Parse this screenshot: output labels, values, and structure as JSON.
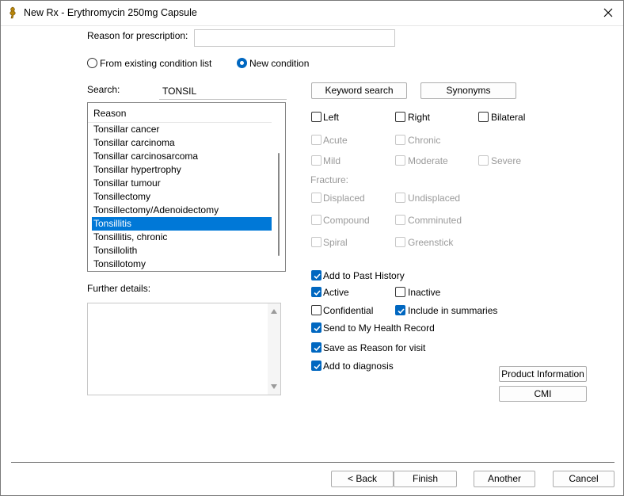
{
  "window": {
    "title": "New Rx - Erythromycin  250mg Capsule",
    "close_label": "×"
  },
  "reason": {
    "label": "Reason for prescription:",
    "value": ""
  },
  "source": {
    "existing_label": "From existing condition list",
    "new_label": "New condition",
    "selected": "new"
  },
  "search": {
    "label": "Search:",
    "value": "TONSIL",
    "keyword_button": "Keyword search",
    "synonyms_button": "Synonyms"
  },
  "results": {
    "header": "Reason",
    "items": [
      "Tonsillar cancer",
      "Tonsillar carcinoma",
      "Tonsillar carcinosarcoma",
      "Tonsillar hypertrophy",
      "Tonsillar tumour",
      "Tonsillectomy",
      "Tonsillectomy/Adenoidectomy",
      "Tonsillitis",
      "Tonsillitis, chronic",
      "Tonsillolith",
      "Tonsillotomy"
    ],
    "selected": "Tonsillitis"
  },
  "further_details": {
    "label": "Further details:",
    "value": ""
  },
  "side": {
    "left": "Left",
    "right": "Right",
    "bilateral": "Bilateral"
  },
  "course": {
    "acute": "Acute",
    "chronic": "Chronic"
  },
  "severity": {
    "mild": "Mild",
    "moderate": "Moderate",
    "severe": "Severe"
  },
  "fracture": {
    "label": "Fracture:",
    "displaced": "Displaced",
    "undisplaced": "Undisplaced",
    "compound": "Compound",
    "comminuted": "Comminuted",
    "spiral": "Spiral",
    "greenstick": "Greenstick"
  },
  "options": {
    "add_past_history": "Add to Past History",
    "active": "Active",
    "inactive": "Inactive",
    "confidential": "Confidential",
    "include_summaries": "Include in summaries",
    "send_mhr": "Send to My Health Record",
    "save_reason_visit": "Save as Reason for visit",
    "add_diagnosis": "Add to diagnosis"
  },
  "info_buttons": {
    "product_info": "Product Information",
    "cmi": "CMI"
  },
  "footer": {
    "back": "< Back",
    "finish": "Finish",
    "another": "Another",
    "cancel": "Cancel"
  },
  "colors": {
    "accent": "#0067c0",
    "selection": "#0078d7"
  }
}
